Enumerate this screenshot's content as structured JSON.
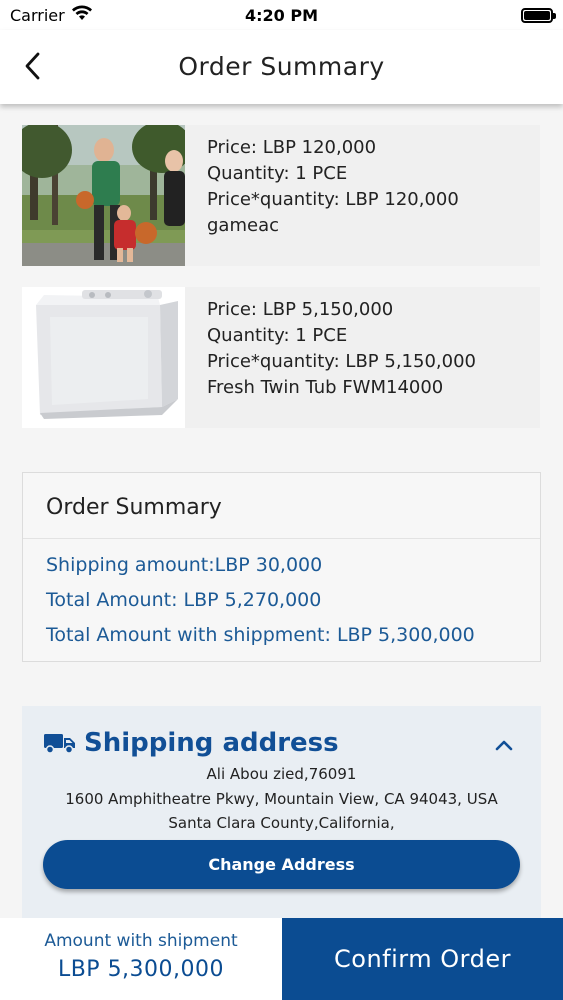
{
  "status_bar": {
    "carrier": "Carrier",
    "time": "4:20 PM"
  },
  "header": {
    "title": "Order Summary"
  },
  "products": [
    {
      "price": "Price: LBP 120,000",
      "quantity": "Quantity: 1 PCE",
      "total": "Price*quantity: LBP 120,000",
      "name": "gameac"
    },
    {
      "price": "Price: LBP 5,150,000",
      "quantity": "Quantity: 1 PCE",
      "total": "Price*quantity: LBP 5,150,000",
      "name": "Fresh Twin Tub FWM14000"
    }
  ],
  "summary": {
    "title": "Order Summary",
    "shipping": "Shipping amount:LBP 30,000",
    "total": "Total Amount: LBP 5,270,000",
    "total_with_shipping": "Total Amount with shippment: LBP 5,300,000"
  },
  "address": {
    "title": "Shipping address",
    "line1": "Ali Abou zied,76091",
    "line2": "1600 Amphitheatre Pkwy, Mountain View, CA 94043, USA",
    "line3": "Santa Clara County,California,",
    "change_label": "Change Address"
  },
  "footer": {
    "amount_label": "Amount with shipment",
    "amount_value": "LBP 5,300,000",
    "confirm_label": "Confirm Order"
  },
  "colors": {
    "primary": "#0b4c92",
    "link_blue": "#1c5a96"
  }
}
